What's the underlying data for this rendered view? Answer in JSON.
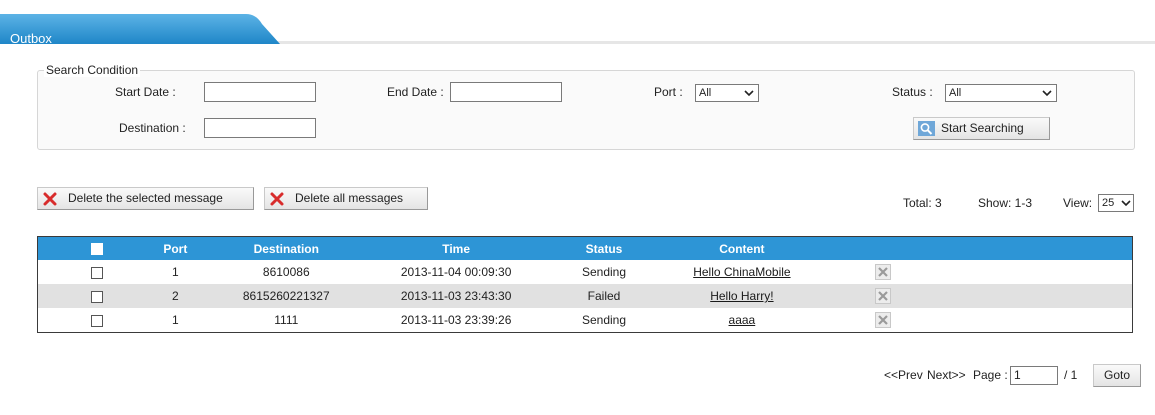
{
  "tab": {
    "label": "Outbox"
  },
  "search": {
    "legend": "Search Condition",
    "start_date_label": "Start Date :",
    "start_date_value": "",
    "end_date_label": "End Date :",
    "end_date_value": "",
    "port_label": "Port :",
    "port_value": "All",
    "status_label": "Status :",
    "status_value": "All",
    "destination_label": "Destination :",
    "destination_value": "",
    "button_label": "Start Searching"
  },
  "toolbar": {
    "delete_selected": "Delete the selected message",
    "delete_all": "Delete all messages"
  },
  "summary": {
    "total": "Total: 3",
    "show": "Show: 1-3",
    "view_label": "View:",
    "view_value": "25"
  },
  "table": {
    "headers": [
      "Port",
      "Destination",
      "Time",
      "Status",
      "Content"
    ],
    "rows": [
      {
        "port": "1",
        "destination": "8610086",
        "time": "2013-11-04 00:09:30",
        "status": "Sending",
        "content": "Hello ChinaMobile"
      },
      {
        "port": "2",
        "destination": "8615260221327",
        "time": "2013-11-03 23:43:30",
        "status": "Failed",
        "content": "Hello Harry!"
      },
      {
        "port": "1",
        "destination": "1111",
        "time": "2013-11-03 23:39:26",
        "status": "Sending",
        "content": "aaaa"
      }
    ]
  },
  "pager": {
    "prev": "<<Prev",
    "next": "Next>>",
    "page_label": "Page :",
    "page_value": "1",
    "of_total": "/ 1",
    "goto": "Goto"
  },
  "colors": {
    "accent": "#2d95d6",
    "alt_row": "#e1e1e1"
  }
}
